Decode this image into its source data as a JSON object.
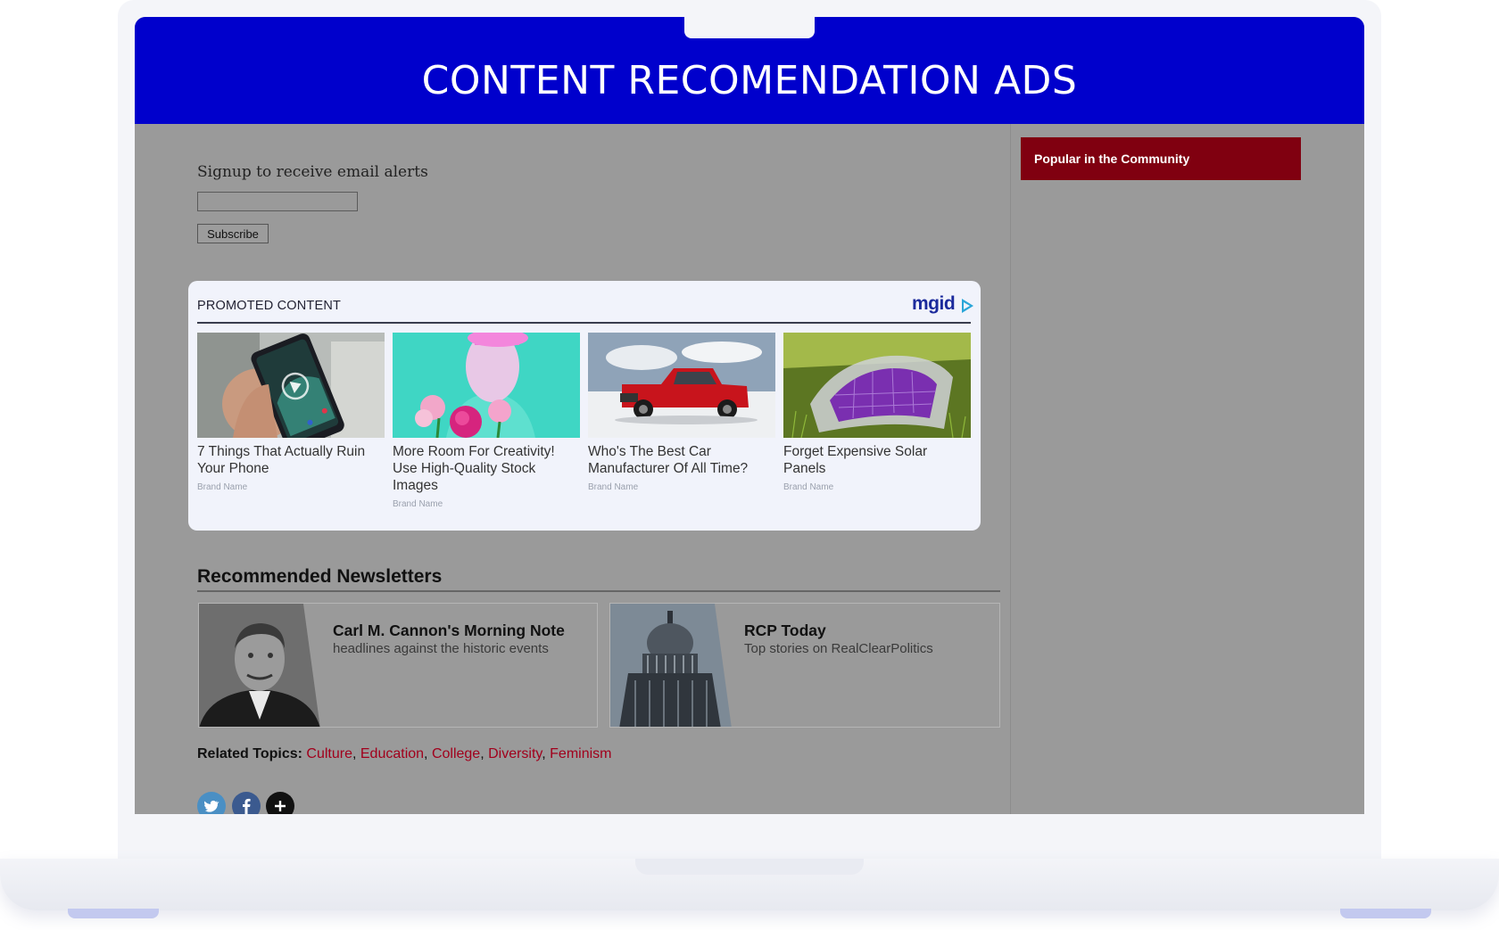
{
  "header": {
    "title": "CONTENT RECOMENDATION ADS"
  },
  "signup": {
    "label": "Signup to receive email alerts",
    "input_value": "",
    "button_label": "Subscribe"
  },
  "promoted": {
    "heading": "PROMOTED CONTENT",
    "logo_text": "mgid",
    "cards": [
      {
        "title": "7 Things That Actually Ruin Your Phone",
        "brand": "Brand Name",
        "image": "phone-in-hand-image"
      },
      {
        "title": "More Room For Creativity! Use High-Quality Stock Images",
        "brand": "Brand Name",
        "image": "pink-hair-flowers-image"
      },
      {
        "title": "Who's The Best Car Manufacturer Of All Time?",
        "brand": "Brand Name",
        "image": "red-pickup-truck-image"
      },
      {
        "title": "Forget Expensive Solar Panels",
        "brand": "Brand Name",
        "image": "flexible-solar-panel-image"
      }
    ]
  },
  "newsletters": {
    "heading": "Recommended Newsletters",
    "items": [
      {
        "name": "Carl M. Cannon's Morning Note",
        "description": "headlines against the historic events",
        "image": "portrait-photo"
      },
      {
        "name": "RCP Today",
        "description": "Top stories on RealClearPolitics",
        "image": "capitol-dome-photo"
      }
    ]
  },
  "related": {
    "label": "Related Topics:",
    "topics": [
      "Culture",
      "Education",
      "College",
      "Diversity",
      "Feminism"
    ]
  },
  "social": [
    {
      "icon": "twitter-icon",
      "glyph": "🐦",
      "color": "#4a8fc4"
    },
    {
      "icon": "facebook-icon",
      "glyph": "f",
      "color": "#3b5a8f"
    },
    {
      "icon": "plus-icon",
      "glyph": "+",
      "color": "#111111"
    }
  ],
  "sidebar": {
    "popular_label": "Popular in the Community"
  },
  "colors": {
    "header": "#0000cc",
    "popular": "#800010",
    "topic_link": "#a1001c",
    "page_bg": "#9a9a9a"
  }
}
